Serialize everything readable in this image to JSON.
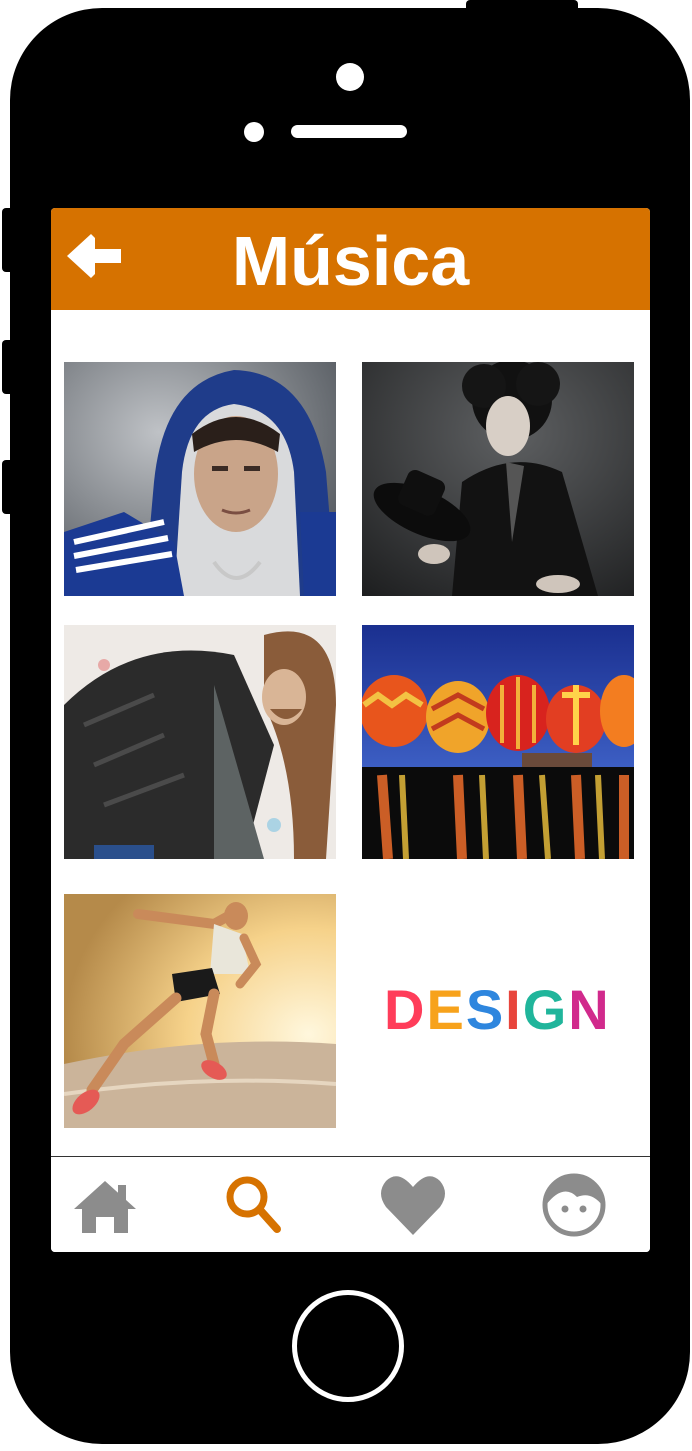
{
  "app": {
    "header": {
      "title": "Música",
      "back_icon": "arrow-left-icon",
      "color": "#d67200"
    },
    "grid": [
      {
        "id": "hooded-singer",
        "icon": "photo"
      },
      {
        "id": "curly-hair-performer",
        "icon": "photo"
      },
      {
        "id": "long-hair-guitarist",
        "icon": "photo"
      },
      {
        "id": "hot-air-balloons",
        "icon": "photo"
      },
      {
        "id": "running-woman",
        "icon": "photo"
      },
      {
        "id": "design-logo",
        "logo_text": "DESIGN"
      }
    ],
    "tabbar": {
      "items": [
        {
          "icon": "home-icon",
          "active": false
        },
        {
          "icon": "search-icon",
          "active": true
        },
        {
          "icon": "heart-icon",
          "active": false
        },
        {
          "icon": "profile-icon",
          "active": false
        }
      ],
      "active_color": "#d67200",
      "inactive_color": "#8c8c8c"
    }
  }
}
